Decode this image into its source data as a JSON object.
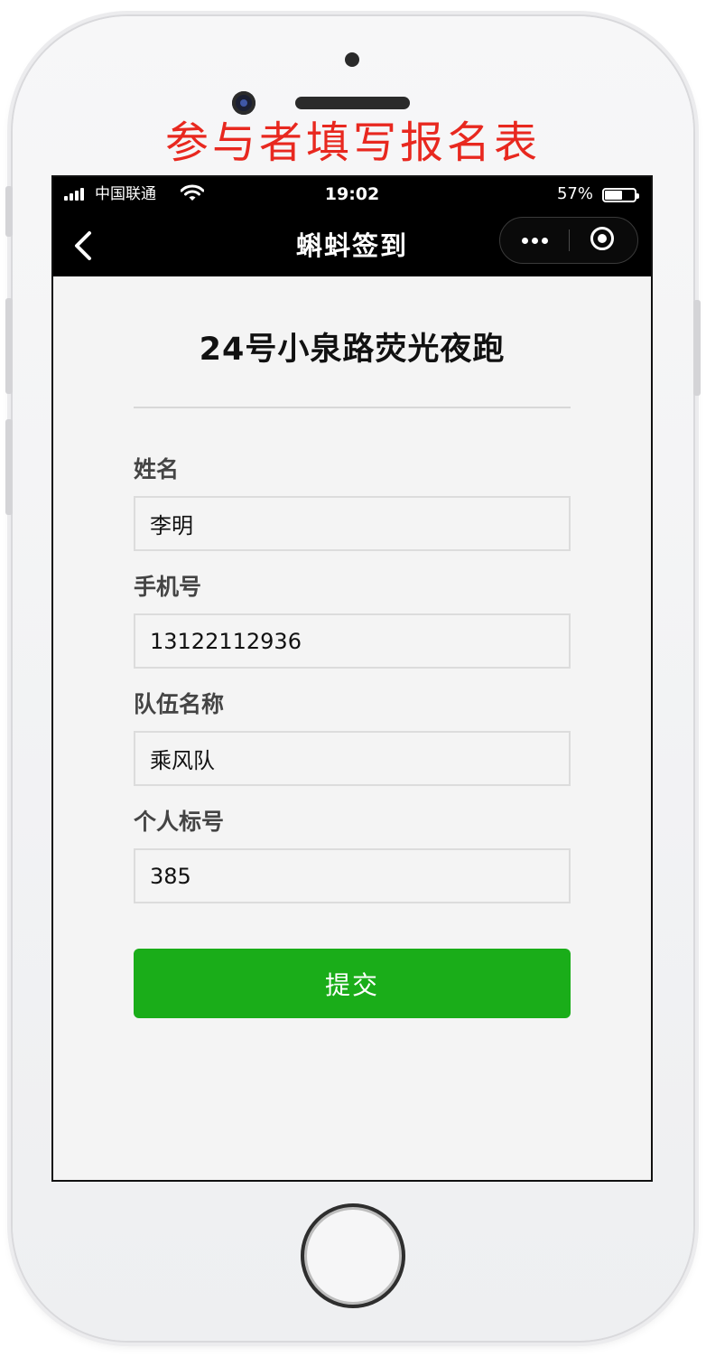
{
  "caption": "参与者填写报名表",
  "status_bar": {
    "carrier": "中国联通",
    "time": "19:02",
    "battery_percent": "57%",
    "battery_level": 0.57
  },
  "nav": {
    "title": "蝌蚪签到"
  },
  "form": {
    "event_title": "24号小泉路荧光夜跑",
    "fields": [
      {
        "label": "姓名",
        "value": "李明"
      },
      {
        "label": "手机号",
        "value": "13122112936"
      },
      {
        "label": "队伍名称",
        "value": "乘风队"
      },
      {
        "label": "个人标号",
        "value": "385"
      }
    ],
    "submit_label": "提交"
  },
  "colors": {
    "caption": "#e8281f",
    "submit_button": "#1aad19",
    "navbar_bg": "#000000",
    "page_bg": "#f4f4f4"
  }
}
